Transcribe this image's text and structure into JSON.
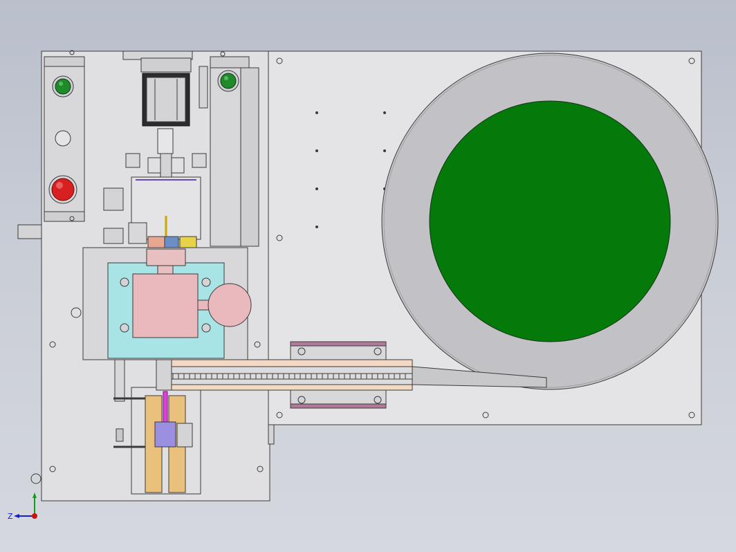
{
  "viewport": {
    "background_top": "#b9bfcb",
    "background_bottom": "#d5d8de"
  },
  "machine": {
    "plate_color": "#e4e4e6",
    "frame_color": "#d6d6d8",
    "line_color": "#3a3a3a",
    "start_button_color": "#1e8a2a",
    "stop_button_color": "#d92020",
    "vibratory_bowl_color": "#c2c2c6",
    "bowl_feed_disc_color": "#047a0b",
    "carriage_color": "#a8e3e6",
    "cylinder_block_color": "#eab9bd",
    "track_rail_color": "#f3d9c4",
    "slider_rail_color": "#e9c17c",
    "clamp_block_color": "#9a8fe0",
    "magenta_pin_color": "#e040e0",
    "guide_bracket_color": "#b07a9a"
  },
  "triad": {
    "x_label": "",
    "y_label": "",
    "z_label": "Z",
    "x_color": "#d01010",
    "y_color": "#10a010",
    "z_color": "#1020d0"
  }
}
